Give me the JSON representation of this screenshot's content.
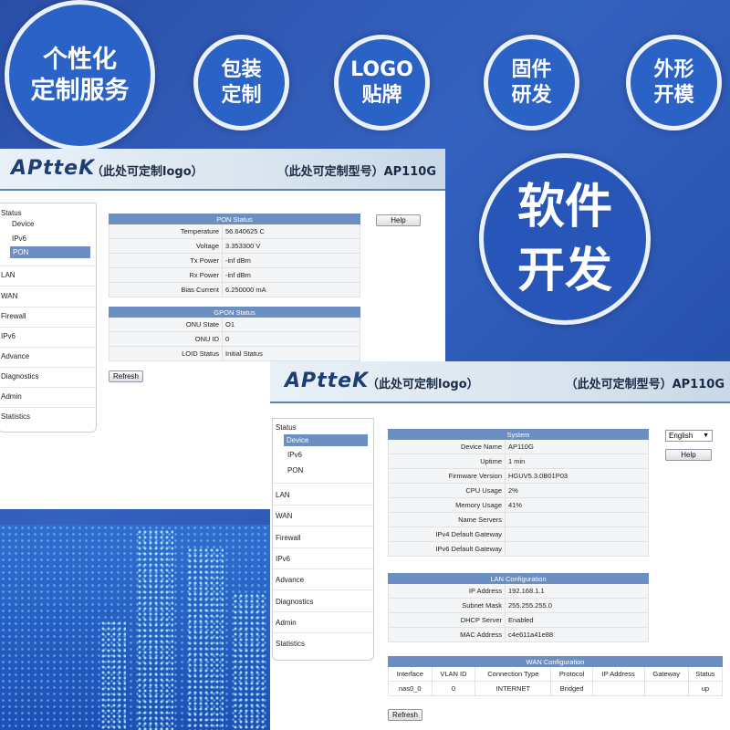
{
  "badges": {
    "custom_service": "个性化\n定制服务",
    "packaging": "包装\n定制",
    "logo_label": "LOGO\n贴牌",
    "firmware": "固件\n研发",
    "mold": "外形\n开模",
    "software": "软件\n开发"
  },
  "panel1": {
    "logo": "APtteK",
    "logo_note": "（此处可定制logo）",
    "model_note": "（此处可定制型号）AP110G",
    "nav": {
      "status": "Status",
      "device": "Device",
      "ipv6": "IPv6",
      "pon": "PON",
      "lan": "LAN",
      "wan": "WAN",
      "firewall": "Firewall",
      "ipv6_top": "IPv6",
      "advance": "Advance",
      "diagnostics": "Diagnostics",
      "admin": "Admin",
      "statistics": "Statistics"
    },
    "pon_status": {
      "title": "PON Status",
      "rows": [
        {
          "k": "Temperature",
          "v": "56.640625 C"
        },
        {
          "k": "Voltage",
          "v": "3.353300 V"
        },
        {
          "k": "Tx Power",
          "v": "-inf dBm"
        },
        {
          "k": "Rx Power",
          "v": "-inf dBm"
        },
        {
          "k": "Bias Current",
          "v": "6.250000 mA"
        }
      ]
    },
    "gpon_status": {
      "title": "GPON Status",
      "rows": [
        {
          "k": "ONU State",
          "v": "O1"
        },
        {
          "k": "ONU ID",
          "v": "0"
        },
        {
          "k": "LOID Status",
          "v": "Initial Status"
        }
      ]
    },
    "help": "Help",
    "refresh": "Refresh"
  },
  "panel2": {
    "logo": "APtteK",
    "logo_note": "（此处可定制logo）",
    "model_note": "（此处可定制型号）AP110G",
    "nav": {
      "status": "Status",
      "device": "Device",
      "ipv6": "IPv6",
      "pon": "PON",
      "lan": "LAN",
      "wan": "WAN",
      "firewall": "Firewall",
      "ipv6_top": "IPv6",
      "advance": "Advance",
      "diagnostics": "Diagnostics",
      "admin": "Admin",
      "statistics": "Statistics"
    },
    "language": "English",
    "help": "Help",
    "system": {
      "title": "System",
      "rows": [
        {
          "k": "Device Name",
          "v": "AP110G"
        },
        {
          "k": "Uptime",
          "v": "1 min"
        },
        {
          "k": "Firmware Version",
          "v": "HGUV5.3.0B01P03"
        },
        {
          "k": "CPU Usage",
          "v": "2%"
        },
        {
          "k": "Memory Usage",
          "v": "41%"
        },
        {
          "k": "Name Servers",
          "v": ""
        },
        {
          "k": "IPv4 Default Gateway",
          "v": ""
        },
        {
          "k": "IPv6 Default Gateway",
          "v": ""
        }
      ]
    },
    "lan_config": {
      "title": "LAN Configuration",
      "rows": [
        {
          "k": "IP Address",
          "v": "192.168.1.1"
        },
        {
          "k": "Subnet Mask",
          "v": "255.255.255.0"
        },
        {
          "k": "DHCP Server",
          "v": "Enabled"
        },
        {
          "k": "MAC Address",
          "v": "c4e611a41e88"
        }
      ]
    },
    "wan_config": {
      "title": "WAN Configuration",
      "headers": [
        "Interface",
        "VLAN ID",
        "Connection Type",
        "Protocol",
        "IP Address",
        "Gateway",
        "Status"
      ],
      "row": [
        "nas0_0",
        "0",
        "INTERNET",
        "Bridged",
        "",
        "",
        "up"
      ]
    },
    "refresh": "Refresh"
  }
}
